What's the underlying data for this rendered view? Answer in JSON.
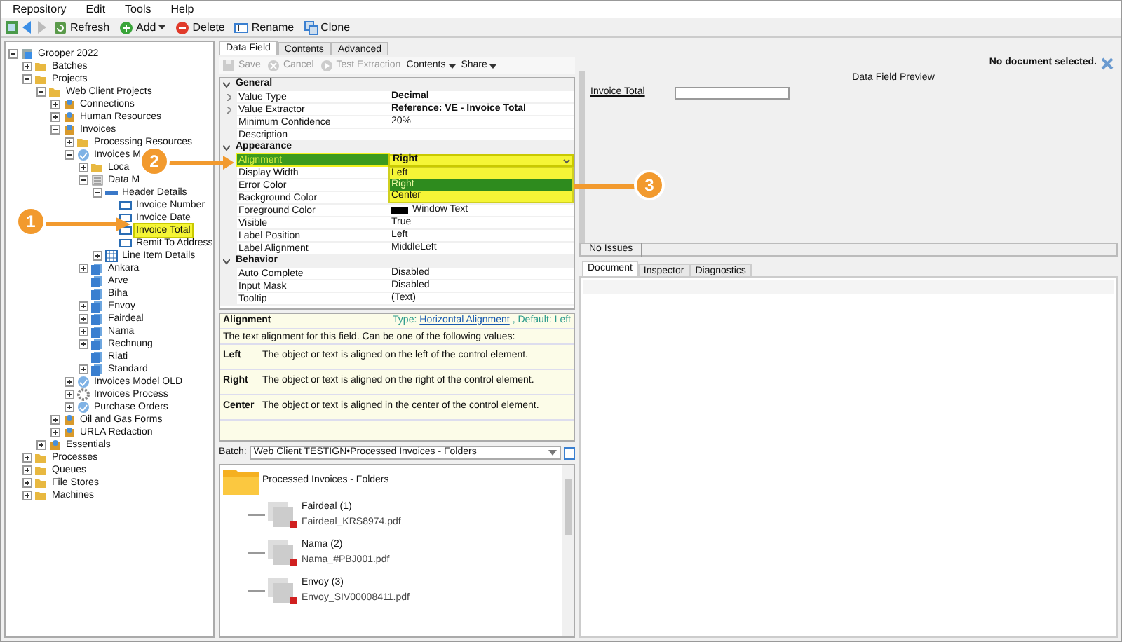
{
  "menu": [
    "Repository",
    "Edit",
    "Tools",
    "Help"
  ],
  "toolbar": [
    {
      "label": "Refresh",
      "kind": "refresh"
    },
    {
      "label": "Add",
      "kind": "add"
    },
    {
      "label": "Delete",
      "kind": "delete"
    },
    {
      "label": "Rename",
      "kind": "rename"
    },
    {
      "label": "Clone",
      "kind": "clone"
    }
  ],
  "tree": [
    {
      "label": "Grooper 2022",
      "kind": "root",
      "expanded": true,
      "selected": false,
      "children": [
        {
          "label": "Batches",
          "kind": "folder",
          "expanded": false,
          "selected": false
        },
        {
          "label": "Projects",
          "kind": "folder",
          "expanded": true,
          "selected": false,
          "children": [
            {
              "label": "Web Client Projects",
              "kind": "folder",
              "expanded": true,
              "selected": false,
              "children": [
                {
                  "label": "Connections",
                  "kind": "project",
                  "expanded": false,
                  "selected": false
                },
                {
                  "label": "Human Resources",
                  "kind": "project",
                  "expanded": false,
                  "selected": false
                },
                {
                  "label": "Invoices",
                  "kind": "project",
                  "expanded": true,
                  "selected": false,
                  "children": [
                    {
                      "label": "Processing Resources",
                      "kind": "folder",
                      "expanded": false,
                      "selected": false
                    },
                    {
                      "label": "Invoices M",
                      "kind": "model",
                      "expanded": true,
                      "selected": false,
                      "children": [
                        {
                          "label": "Loca",
                          "kind": "folder",
                          "expanded": false,
                          "selected": false
                        },
                        {
                          "label": "Data M",
                          "kind": "datamodel",
                          "expanded": true,
                          "selected": false,
                          "children": [
                            {
                              "label": "Header Details",
                              "kind": "section",
                              "expanded": true,
                              "selected": false,
                              "children": [
                                {
                                  "label": "Invoice Number",
                                  "kind": "field",
                                  "selected": false
                                },
                                {
                                  "label": "Invoice Date",
                                  "kind": "field",
                                  "selected": false
                                },
                                {
                                  "label": "Invoice Total",
                                  "kind": "field",
                                  "selected": true
                                },
                                {
                                  "label": "Remit To Address",
                                  "kind": "field",
                                  "selected": false
                                }
                              ]
                            },
                            {
                              "label": "Line Item Details",
                              "kind": "table",
                              "expanded": false,
                              "selected": false
                            }
                          ]
                        },
                        {
                          "label": "Ankara",
                          "kind": "class",
                          "expanded": false,
                          "selected": false
                        },
                        {
                          "label": "Arve",
                          "kind": "class",
                          "selected": false
                        },
                        {
                          "label": "Biha",
                          "kind": "class",
                          "selected": false
                        },
                        {
                          "label": "Envoy",
                          "kind": "class",
                          "expanded": false,
                          "selected": false
                        },
                        {
                          "label": "Fairdeal",
                          "kind": "class",
                          "expanded": false,
                          "selected": false
                        },
                        {
                          "label": "Nama",
                          "kind": "class",
                          "expanded": false,
                          "selected": false
                        },
                        {
                          "label": "Rechnung",
                          "kind": "class",
                          "expanded": false,
                          "selected": false
                        },
                        {
                          "label": "Riati",
                          "kind": "class",
                          "selected": false
                        },
                        {
                          "label": "Standard",
                          "kind": "class",
                          "expanded": false,
                          "selected": false
                        }
                      ]
                    },
                    {
                      "label": "Invoices Model OLD",
                      "kind": "model",
                      "expanded": false,
                      "selected": false
                    },
                    {
                      "label": "Invoices Process",
                      "kind": "process",
                      "expanded": false,
                      "selected": false
                    },
                    {
                      "label": "Purchase Orders",
                      "kind": "model",
                      "expanded": false,
                      "selected": false
                    }
                  ]
                },
                {
                  "label": "Oil and Gas Forms",
                  "kind": "project",
                  "expanded": false,
                  "selected": false
                },
                {
                  "label": "URLA Redaction",
                  "kind": "project",
                  "expanded": false,
                  "selected": false
                }
              ]
            },
            {
              "label": "Essentials",
              "kind": "project",
              "expanded": false,
              "selected": false
            }
          ]
        },
        {
          "label": "Processes",
          "kind": "folder",
          "expanded": false,
          "selected": false
        },
        {
          "label": "Queues",
          "kind": "folder",
          "expanded": false,
          "selected": false
        },
        {
          "label": "File Stores",
          "kind": "folder",
          "expanded": false,
          "selected": false
        },
        {
          "label": "Machines",
          "kind": "folder",
          "expanded": false,
          "selected": false
        }
      ]
    }
  ],
  "editor_tabs": [
    {
      "label": "Data Field",
      "selected": true
    },
    {
      "label": "Contents",
      "selected": false
    },
    {
      "label": "Advanced",
      "selected": false
    }
  ],
  "editor_toolbar": [
    {
      "label": "Save",
      "kind": "save",
      "disabled": true
    },
    {
      "label": "Cancel",
      "kind": "cancel",
      "disabled": true
    },
    {
      "label": "Test Extraction",
      "kind": "test",
      "disabled": true
    },
    {
      "label": "Contents",
      "kind": "menu",
      "disabled": false
    },
    {
      "label": "Share",
      "kind": "menu",
      "disabled": false
    }
  ],
  "properties": [
    {
      "category": "General",
      "expanded": true,
      "rows": [
        {
          "label": "Value Type",
          "value": "Decimal",
          "bold": true,
          "expandable": true,
          "kind": "text",
          "selected": false
        },
        {
          "label": "Value Extractor",
          "value": "Reference: VE - Invoice Total",
          "bold": true,
          "expandable": true,
          "kind": "text",
          "selected": false
        },
        {
          "label": "Minimum Confidence",
          "value": "20%",
          "bold": false,
          "expandable": false,
          "kind": "text",
          "selected": false
        },
        {
          "label": "Description",
          "expandable": false,
          "kind": "text",
          "selected": false
        }
      ]
    },
    {
      "category": "Appearance",
      "expanded": true,
      "rows": [
        {
          "label": "Alignment",
          "value": "Right",
          "bold": true,
          "expandable": false,
          "kind": "dropdown",
          "selected": true,
          "options": [
            {
              "label": "Left",
              "selected": false
            },
            {
              "label": "Right",
              "selected": true
            },
            {
              "label": "Center",
              "selected": false
            }
          ]
        },
        {
          "label": "Display Width",
          "expandable": false,
          "kind": "text",
          "selected": false
        },
        {
          "label": "Error Color",
          "expandable": false,
          "kind": "text",
          "selected": false
        },
        {
          "label": "Background Color",
          "expandable": false,
          "kind": "text",
          "selected": false
        },
        {
          "label": "Foreground Color",
          "value": "Window Text",
          "bold": false,
          "expandable": false,
          "kind": "color",
          "selected": false
        },
        {
          "label": "Visible",
          "value": "True",
          "bold": false,
          "expandable": false,
          "kind": "text",
          "selected": false
        },
        {
          "label": "Label Position",
          "value": "Left",
          "bold": false,
          "expandable": false,
          "kind": "text",
          "selected": false
        },
        {
          "label": "Label Alignment",
          "value": "MiddleLeft",
          "bold": false,
          "expandable": false,
          "kind": "text",
          "selected": false
        }
      ]
    },
    {
      "category": "Behavior",
      "expanded": true,
      "rows": [
        {
          "label": "Auto Complete",
          "value": "Disabled",
          "bold": false,
          "expandable": false,
          "kind": "text",
          "selected": false
        },
        {
          "label": "Input Mask",
          "value": "Disabled",
          "bold": false,
          "expandable": false,
          "kind": "text",
          "selected": false
        },
        {
          "label": "Tooltip",
          "value": "(Text)",
          "bold": false,
          "expandable": false,
          "kind": "text",
          "selected": false
        }
      ]
    }
  ],
  "help": {
    "title": "Alignment",
    "type_label": "Type:",
    "type_link": "Horizontal Alignment",
    "default_label": ", Default: Left",
    "description": "The text alignment for this field. Can be one of the following values:",
    "values": [
      {
        "name": "Left",
        "text": "The object or text is aligned on the left of the control element."
      },
      {
        "name": "Right",
        "text": "The object or text is aligned on the right of the control element."
      },
      {
        "name": "Center",
        "text": "The object or text is aligned in the center of the control element."
      }
    ]
  },
  "batch": {
    "label": "Batch:",
    "value": "Web Client TESTIGN•Processed Invoices - Folders",
    "folder": "Processed Invoices - Folders",
    "documents": [
      {
        "name": "Fairdeal (1)",
        "file": "Fairdeal_KRS8974.pdf"
      },
      {
        "name": "Nama (2)",
        "file": "Nama_#PBJ001.pdf"
      },
      {
        "name": "Envoy (3)",
        "file": "Envoy_SIV00008411.pdf"
      }
    ]
  },
  "preview": {
    "status": "No document selected.",
    "title": "Data Field Preview",
    "field_label": "Invoice Total"
  },
  "issues": "No Issues",
  "viewer_tabs": [
    {
      "label": "Document",
      "selected": true
    },
    {
      "label": "Inspector",
      "selected": false
    },
    {
      "label": "Diagnostics",
      "selected": false
    }
  ],
  "callouts": [
    {
      "label": "1"
    },
    {
      "label": "2"
    },
    {
      "label": "3"
    }
  ]
}
